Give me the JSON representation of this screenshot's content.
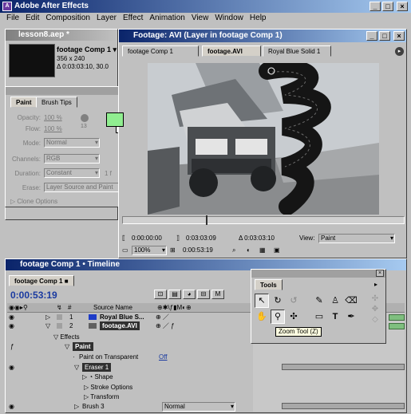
{
  "app": {
    "title": "Adobe After Effects"
  },
  "menu": [
    "File",
    "Edit",
    "Composition",
    "Layer",
    "Effect",
    "Animation",
    "View",
    "Window",
    "Help"
  ],
  "project": {
    "title": "lesson8.aep *",
    "item_name": "footage Comp 1 ▾",
    "item_size": "356 x 240",
    "item_duration": "Δ 0:03:03:10, 30.0"
  },
  "paint": {
    "tabs": [
      "Paint",
      "Brush Tips"
    ],
    "opacity_label": "Opacity:",
    "opacity_value": "100 %",
    "flow_label": "Flow:",
    "flow_value": "100 %",
    "brush_size": "13",
    "mode_label": "Mode:",
    "mode_value": "Normal",
    "channels_label": "Channels:",
    "channels_value": "RGB",
    "duration_label": "Duration:",
    "duration_value": "Constant",
    "duration_frames": "1 f",
    "erase_label": "Erase:",
    "erase_value": "Layer Source and Paint",
    "clone_options": "▷ Clone Options",
    "fg_color": "#90ee90",
    "bg_color": "#ffffff"
  },
  "footage": {
    "title": "Footage: AVI (Layer in footage Comp 1)",
    "tabs": [
      "footage Comp 1",
      "footage.AVI",
      "Royal Blue Solid 1"
    ],
    "time_start": "0:00:00:00",
    "time_end": "0:03:03:09",
    "time_duration": "Δ 0:03:03:10",
    "view_label": "View:",
    "view_value": "Paint",
    "zoom": "100%",
    "current_time": "0:00:53:19"
  },
  "timeline": {
    "title": "footage Comp 1 • Timeline",
    "tab": "footage Comp 1",
    "current_time": "0:00:53:19",
    "col_source_name": "Source Name",
    "layers": [
      {
        "num": "1",
        "name": "Royal Blue S...",
        "color": "#1e3cc8"
      },
      {
        "num": "2",
        "name": "footage.AVI",
        "color": "#a0a0a0"
      }
    ],
    "rows": {
      "effects": "Effects",
      "paint": "Paint",
      "paint_on_transparent": "Paint on Transparent",
      "off": "Off",
      "eraser": "Eraser 1",
      "shape": "Shape",
      "stroke_options": "Stroke Options",
      "transform": "Transform",
      "brush": "Brush 3",
      "mode_value": "Normal"
    }
  },
  "tools": {
    "title": "Tools",
    "tooltip": "Zoom Tool (Z)",
    "icons": [
      "selection-tool-icon",
      "rotate-tool-icon",
      "orbit-tool-icon",
      "brush-tool-icon",
      "clone-stamp-tool-icon",
      "eraser-tool-icon",
      "hand-tool-icon",
      "zoom-tool-icon",
      "pan-behind-tool-icon",
      "rectangle-mask-tool-icon",
      "text-tool-icon",
      "pen-tool-icon"
    ]
  }
}
